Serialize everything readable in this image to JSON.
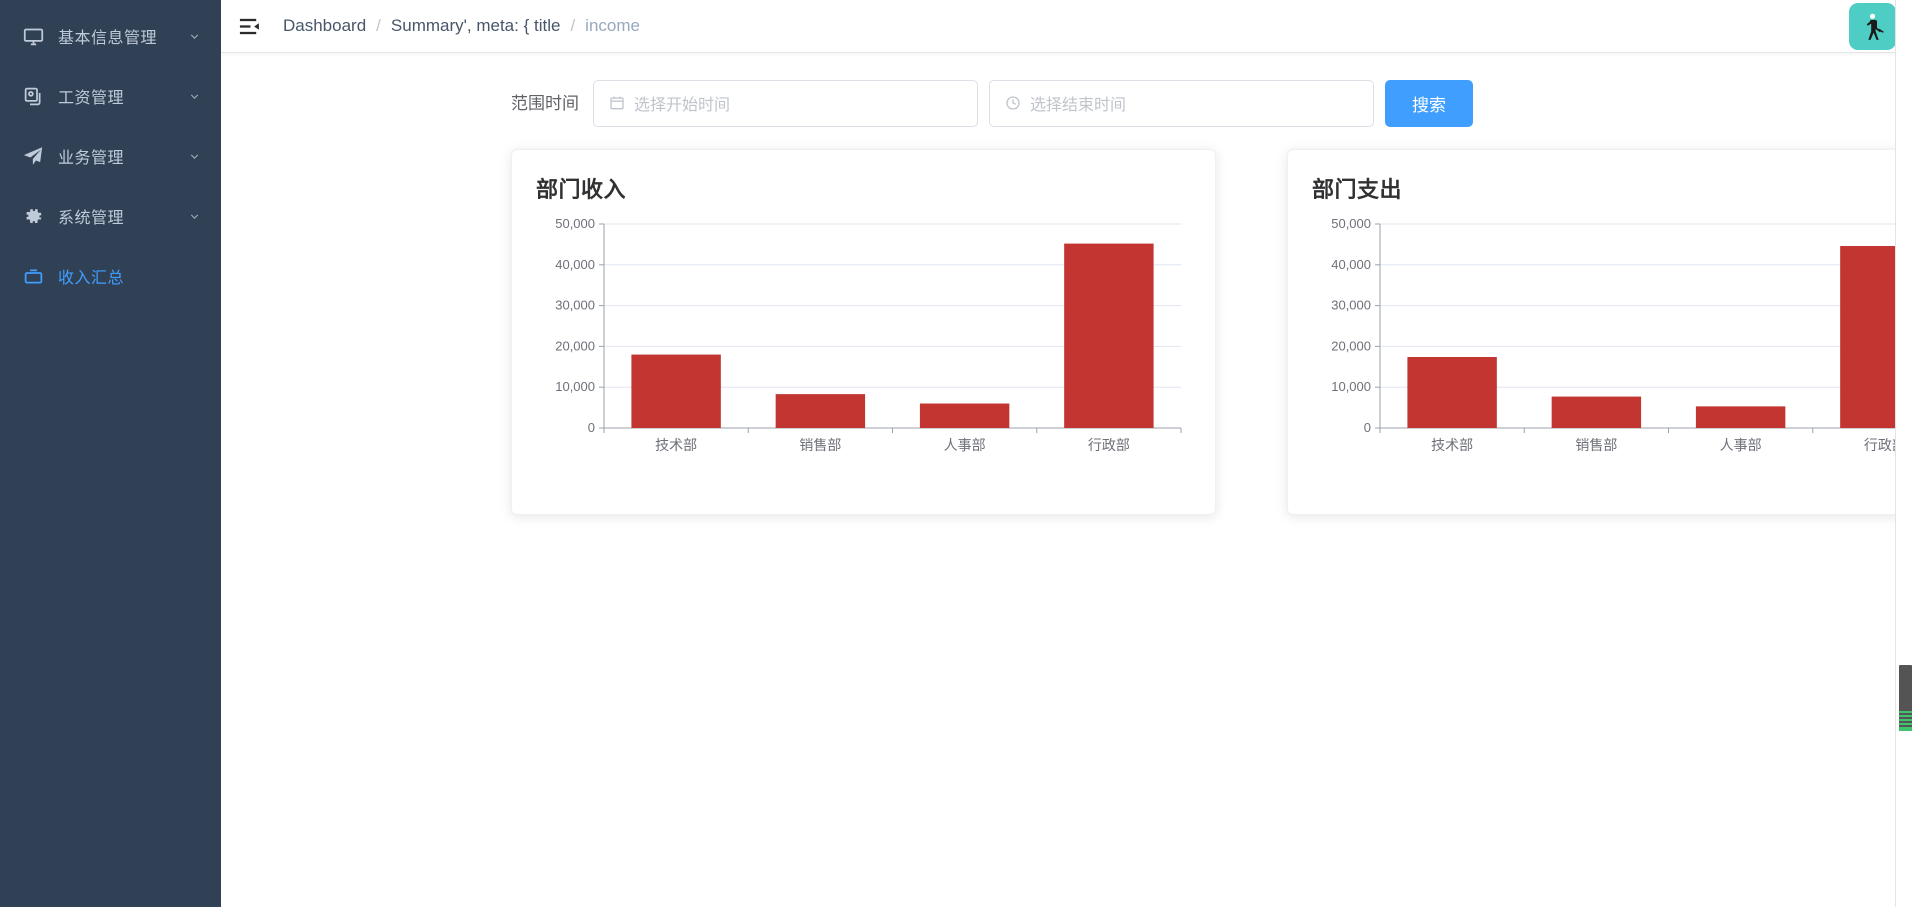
{
  "sidebar": {
    "items": [
      {
        "label": "基本信息管理",
        "icon": "monitor-icon",
        "has_arrow": true,
        "active": false
      },
      {
        "label": "工资管理",
        "icon": "copy-documents-icon",
        "has_arrow": true,
        "active": false
      },
      {
        "label": "业务管理",
        "icon": "paper-plane-icon",
        "has_arrow": true,
        "active": false
      },
      {
        "label": "系统管理",
        "icon": "gear-icon",
        "has_arrow": true,
        "active": false
      },
      {
        "label": "收入汇总",
        "icon": "briefcase-icon",
        "has_arrow": false,
        "active": true
      }
    ],
    "background_color": "#304156",
    "active_color": "#409eff"
  },
  "navbar": {
    "hamburger_icon": "hamburger-fold-icon",
    "breadcrumb": [
      {
        "text": "Dashboard",
        "current": false
      },
      {
        "text": "Summary', meta: { title",
        "current": false
      },
      {
        "text": "income",
        "current": true
      }
    ],
    "separator": "/",
    "avatar": {
      "icon": "user-avatar-icon",
      "background_color": "#4ecdc4"
    },
    "avatar_caret_icon": "caret-down-icon"
  },
  "filter": {
    "label": "范围时间",
    "start": {
      "placeholder": "选择开始时间",
      "value": "",
      "icon": "calendar-icon"
    },
    "end": {
      "placeholder": "选择结束时间",
      "value": "",
      "icon": "clock-icon"
    },
    "search_button": "搜索",
    "search_button_color": "#409eff"
  },
  "chart_data": [
    {
      "type": "bar",
      "title": "部门收入",
      "categories": [
        "技术部",
        "销售部",
        "人事部",
        "行政部"
      ],
      "values": [
        18000,
        8300,
        6000,
        45200
      ],
      "tick_labels": [
        "0",
        "10,000",
        "20,000",
        "30,000",
        "40,000",
        "50,000"
      ],
      "ticks": [
        0,
        10000,
        20000,
        30000,
        40000,
        50000
      ],
      "ylim": [
        0,
        50000
      ],
      "xlabel": "",
      "ylabel": "",
      "grid": true,
      "legend": "none",
      "bar_color": "#c23531"
    },
    {
      "type": "bar",
      "title": "部门支出",
      "categories": [
        "技术部",
        "销售部",
        "人事部",
        "行政部"
      ],
      "values": [
        17400,
        7700,
        5300,
        44600
      ],
      "tick_labels": [
        "0",
        "10,000",
        "20,000",
        "30,000",
        "40,000",
        "50,000"
      ],
      "ticks": [
        0,
        10000,
        20000,
        30000,
        40000,
        50000
      ],
      "ylim": [
        0,
        50000
      ],
      "xlabel": "",
      "ylabel": "",
      "grid": true,
      "legend": "none",
      "bar_color": "#c23531"
    }
  ]
}
